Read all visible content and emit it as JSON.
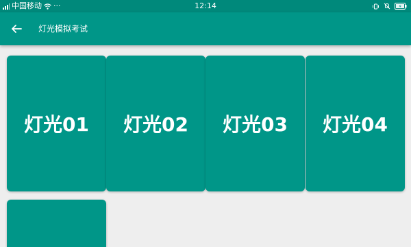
{
  "status_bar": {
    "carrier": "中国移动",
    "more": "···",
    "time": "12:14",
    "icons": [
      "signal-icon",
      "wifi-icon",
      "vibrate-icon",
      "bell-off-icon",
      "battery-icon"
    ]
  },
  "app_bar": {
    "back_icon": "arrow-left-icon",
    "title": "灯光模拟考试"
  },
  "tiles": [
    {
      "label": "灯光01"
    },
    {
      "label": "灯光02"
    },
    {
      "label": "灯光03"
    },
    {
      "label": "灯光04"
    },
    {
      "label": ""
    }
  ],
  "colors": {
    "status_bar": "#00897b",
    "app_bar": "#009688",
    "tile": "#009688",
    "background": "#eeeeee",
    "text": "#ffffff"
  }
}
